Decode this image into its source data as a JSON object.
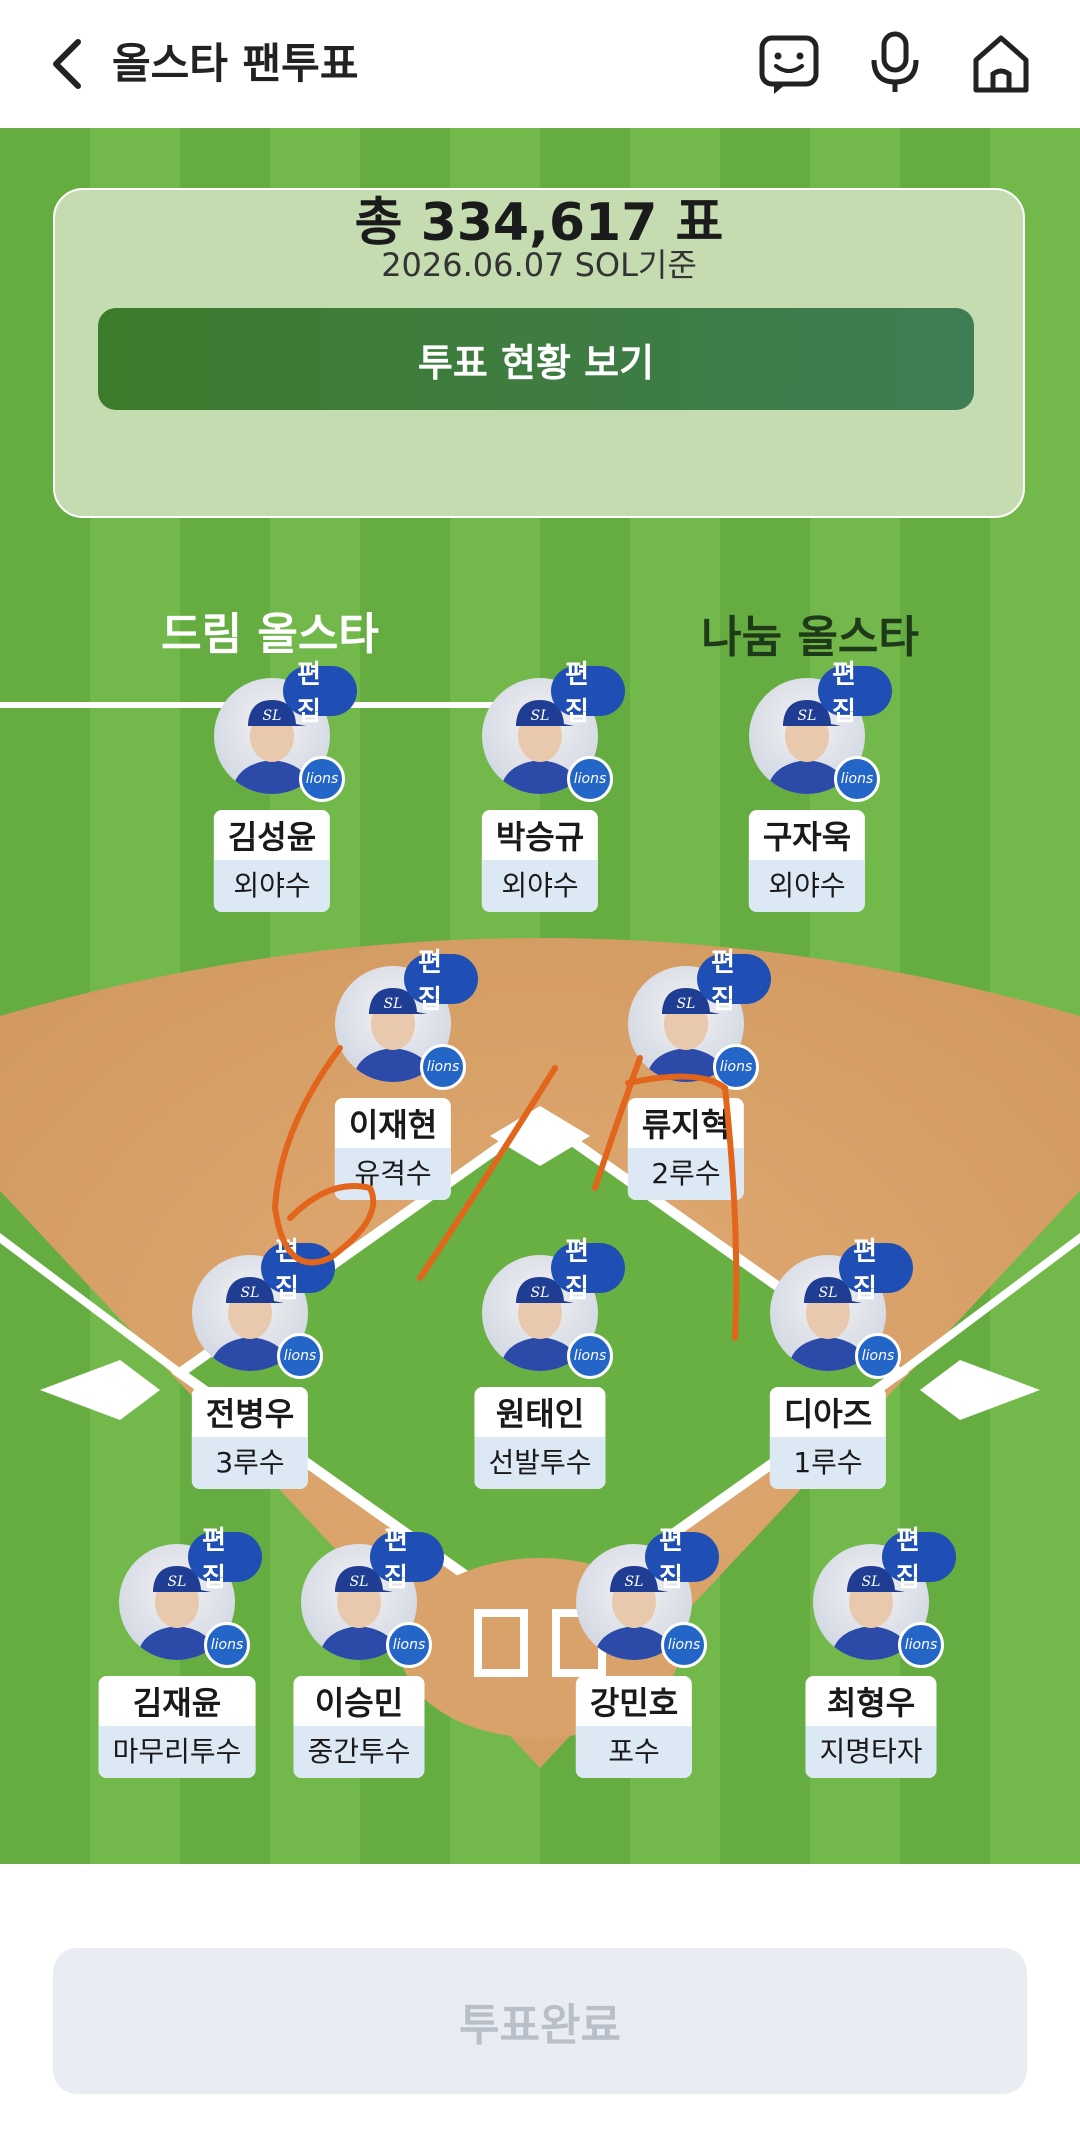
{
  "header": {
    "title": "올스타 팬투표",
    "icons": [
      "back-chevron-icon",
      "chat-icon",
      "microphone-icon",
      "home-icon"
    ]
  },
  "card": {
    "total": "총 334,617 표",
    "date": "2026.06.07 SOL기준",
    "status_button": "투표 현황 보기"
  },
  "tabs": [
    {
      "label": "드림 올스타",
      "active": true
    },
    {
      "label": "나눔 올스타",
      "active": false
    }
  ],
  "edit_label": "편집",
  "logo_text": "lions",
  "players": [
    {
      "name": "김성윤",
      "position": "외야수"
    },
    {
      "name": "박승규",
      "position": "외야수"
    },
    {
      "name": "구자욱",
      "position": "외야수"
    },
    {
      "name": "이재현",
      "position": "유격수"
    },
    {
      "name": "류지혁",
      "position": "2루수"
    },
    {
      "name": "전병우",
      "position": "3루수"
    },
    {
      "name": "원태인",
      "position": "선발투수"
    },
    {
      "name": "디아즈",
      "position": "1루수"
    },
    {
      "name": "김재윤",
      "position": "마무리투수"
    },
    {
      "name": "이승민",
      "position": "중간투수"
    },
    {
      "name": "강민호",
      "position": "포수"
    },
    {
      "name": "최형우",
      "position": "지명타자"
    }
  ],
  "annotation": {
    "text": "6/17",
    "color": "#e2651c"
  },
  "footer": {
    "done_button": "투표완료"
  },
  "colors": {
    "field_green": "#6db446",
    "infield_dirt": "#d9a26a",
    "edit_badge": "#1f4fb5",
    "active_tab": "#ffffff"
  }
}
